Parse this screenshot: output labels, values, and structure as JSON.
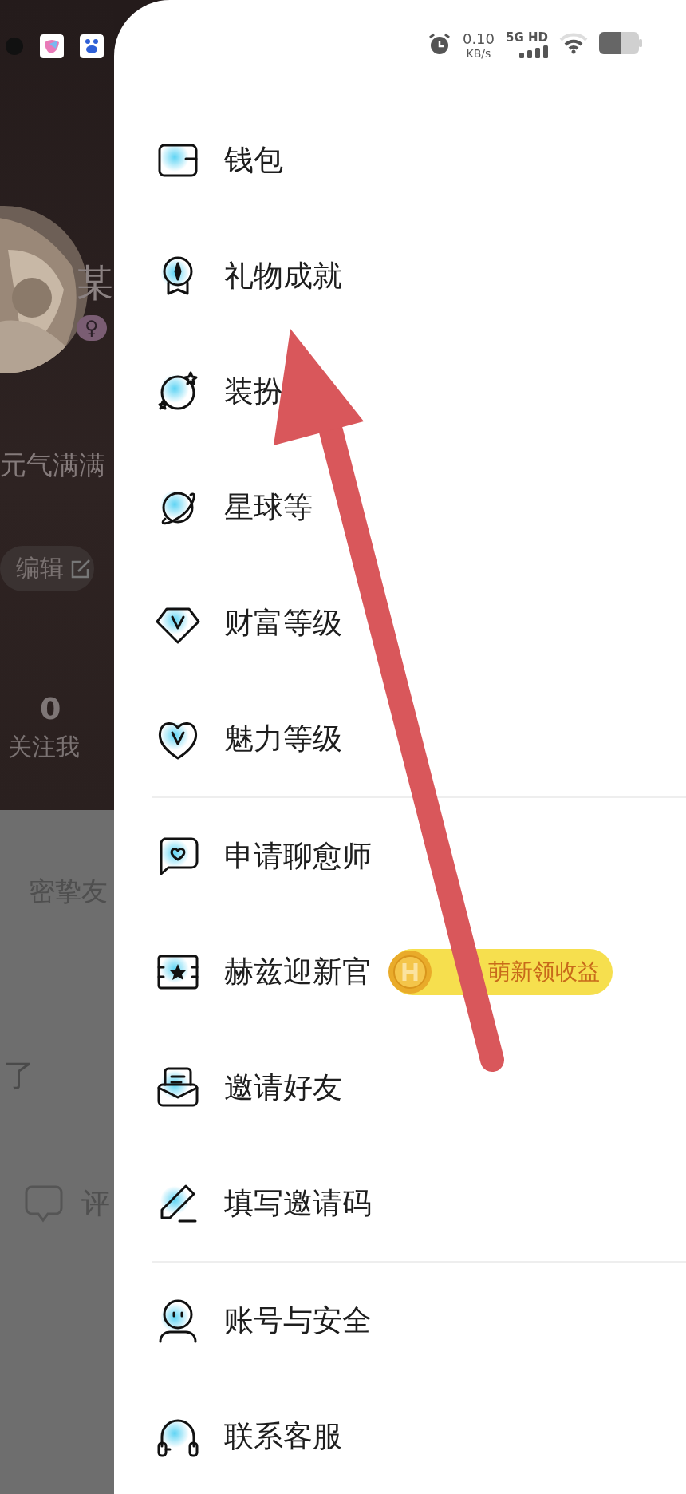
{
  "status_bar": {
    "speed": "0.10",
    "speed_unit": "KB/s",
    "network": "5G HD"
  },
  "background_page": {
    "name": "某",
    "gender_badge": "♀",
    "bio": "元气满满",
    "edit_button": "编辑",
    "stat_value": "0",
    "stat_label": "关注我",
    "section_title": "密挚友",
    "post_text": "了",
    "comment_label": "评"
  },
  "menu_groups": [
    {
      "items": [
        {
          "label": "钱包"
        },
        {
          "label": "礼物成就"
        },
        {
          "label": "装扮"
        },
        {
          "label": "星球等"
        },
        {
          "label": "财富等级"
        },
        {
          "label": "魅力等级"
        }
      ]
    },
    {
      "items": [
        {
          "label": "申请聊愈师"
        },
        {
          "label": "赫兹迎新官",
          "badge": "萌新领收益"
        },
        {
          "label": "邀请好友"
        },
        {
          "label": "填写邀请码"
        }
      ]
    },
    {
      "items": [
        {
          "label": "账号与安全"
        },
        {
          "label": "联系客服"
        }
      ]
    }
  ]
}
